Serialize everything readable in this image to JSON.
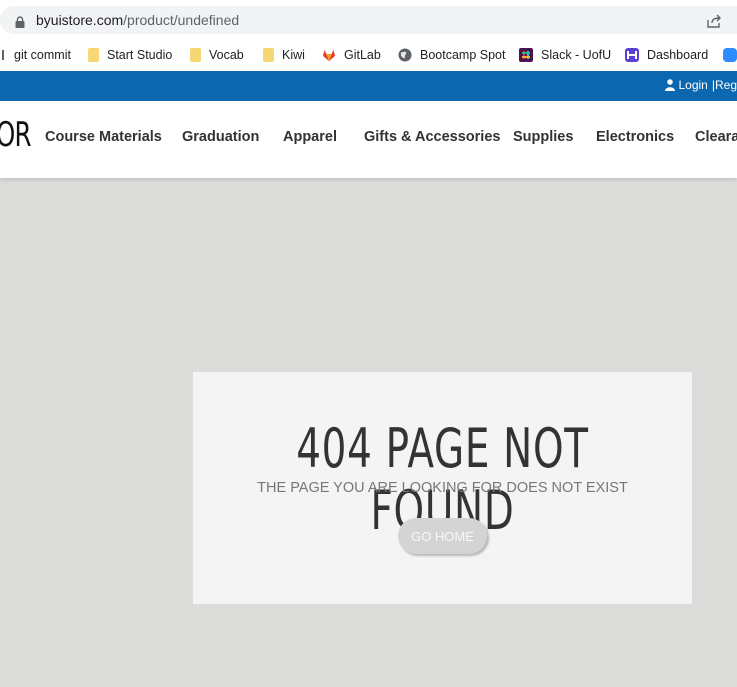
{
  "browser": {
    "url_host": "byuistore.com",
    "url_path": "/product/undefined"
  },
  "bookmarks": [
    {
      "label": "git commit",
      "icon": "partial-icon"
    },
    {
      "label": "Start Studio",
      "icon": "folder-icon"
    },
    {
      "label": "Vocab",
      "icon": "folder-icon"
    },
    {
      "label": "Kiwi",
      "icon": "folder-icon"
    },
    {
      "label": "GitLab",
      "icon": "gitlab-icon"
    },
    {
      "label": "Bootcamp Spot",
      "icon": "globe-icon"
    },
    {
      "label": "Slack - UofU",
      "icon": "slack-icon"
    },
    {
      "label": "Dashboard",
      "icon": "dashboard-icon"
    }
  ],
  "topbar": {
    "login_label": "Login",
    "register_fragment": "|Reg"
  },
  "store": {
    "logo_fragment": "OR",
    "nav": [
      "Course Materials",
      "Graduation",
      "Apparel",
      "Gifts & Accessories",
      "Supplies",
      "Electronics",
      "Cleara"
    ]
  },
  "error": {
    "title": "404 PAGE NOT FOUND",
    "subtitle": "THE PAGE YOU ARE LOOKING FOR DOES NOT EXIST",
    "button_label": "GO HOME"
  },
  "colors": {
    "topbar_blue": "#0a67b0",
    "page_bg": "#dcdddb",
    "card_bg": "#f4f4f4"
  }
}
